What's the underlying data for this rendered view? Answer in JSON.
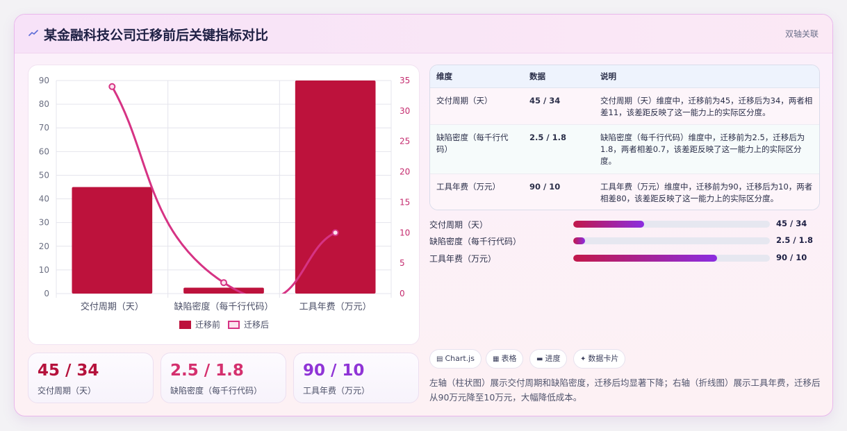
{
  "header": {
    "title": "某金融科技公司迁移前后关键指标对比",
    "mode_tag": "双轴关联"
  },
  "chart_data": {
    "type": "bar",
    "categories": [
      "交付周期（天）",
      "缺陷密度（每千行代码）",
      "工具年费（万元）"
    ],
    "series": [
      {
        "name": "迁移前",
        "type": "bar",
        "axis": "left",
        "values": [
          45,
          2.5,
          90
        ],
        "color": "#bd123c"
      },
      {
        "name": "迁移后",
        "type": "line",
        "axis": "right",
        "values": [
          34,
          1.8,
          10
        ],
        "color": "#d63384"
      }
    ],
    "y_left": {
      "min": 0,
      "max": 90,
      "ticks": [
        0,
        10,
        20,
        30,
        40,
        50,
        60,
        70,
        80,
        90
      ]
    },
    "y_right": {
      "min": 0,
      "max": 35,
      "ticks": [
        0,
        5,
        10,
        15,
        20,
        25,
        30,
        35
      ]
    },
    "legend_position": "bottom",
    "grid": true
  },
  "table": {
    "headers": [
      "维度",
      "数据",
      "说明"
    ],
    "rows": [
      {
        "dim": "交付周期（天）",
        "data": "45 / 34",
        "desc": "交付周期（天）维度中，迁移前为45，迁移后为34，两者相差11，该差距反映了这一能力上的实际区分度。"
      },
      {
        "dim": "缺陷密度（每千行代码）",
        "data": "2.5 / 1.8",
        "desc": "缺陷密度（每千行代码）维度中，迁移前为2.5，迁移后为1.8，两者相差0.7，该差距反映了这一能力上的实际区分度。"
      },
      {
        "dim": "工具年费（万元）",
        "data": "90 / 10",
        "desc": "工具年费（万元）维度中，迁移前为90，迁移后为10，两者相差80，该差距反映了这一能力上的实际区分度。"
      }
    ]
  },
  "progress": [
    {
      "label": "交付周期（天）",
      "value": "45 / 34",
      "fraction": 0.36
    },
    {
      "label": "缺陷密度（每千行代码）",
      "value": "2.5 / 1.8",
      "fraction": 0.06
    },
    {
      "label": "工具年费（万元）",
      "value": "90 / 10",
      "fraction": 0.73
    }
  ],
  "stats": [
    {
      "value": "45 / 34",
      "label": "交付周期（天）",
      "color": "#b5123c"
    },
    {
      "value": "2.5 / 1.8",
      "label": "缺陷密度（每千行代码）",
      "color": "#d4306e"
    },
    {
      "value": "90 / 10",
      "label": "工具年费（万元）",
      "color": "#8f34d6"
    }
  ],
  "chips": [
    {
      "icon": "chart-icon",
      "glyph": "▤",
      "label": "Chart.js"
    },
    {
      "icon": "table-icon",
      "glyph": "▦",
      "label": "表格"
    },
    {
      "icon": "progress-icon",
      "glyph": "▬",
      "label": "进度"
    },
    {
      "icon": "sparkle-icon",
      "glyph": "✦",
      "label": "数据卡片"
    }
  ],
  "note": "左轴（柱状图）展示交付周期和缺陷密度，迁移后均显著下降；右轴（折线图）展示工具年费，迁移后从90万元降至10万元，大幅降低成本。"
}
